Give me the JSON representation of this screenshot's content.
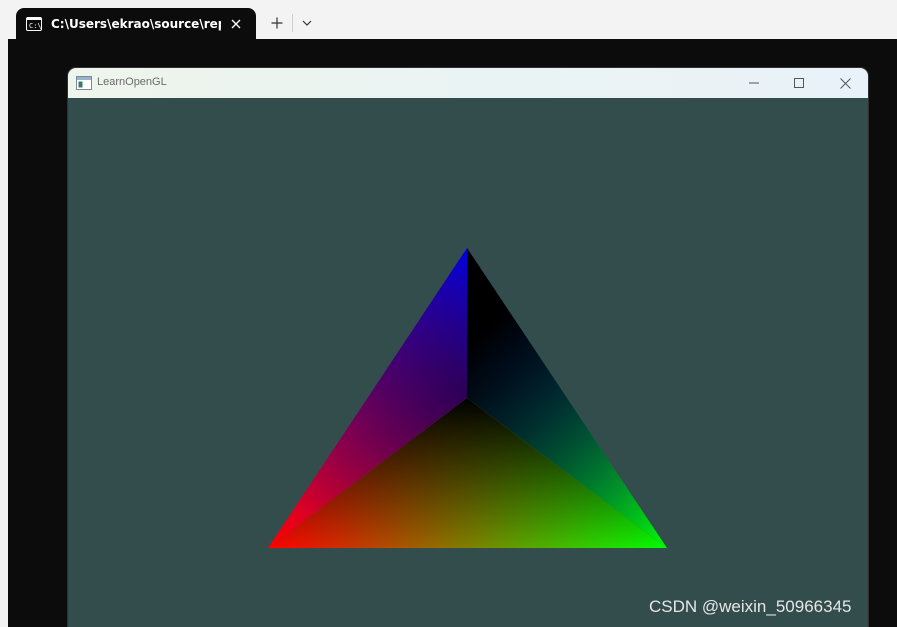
{
  "terminal": {
    "tab_title": "C:\\Users\\ekrao\\source\\repos\\",
    "tab_icon": "terminal-icon",
    "new_tab_icon": "plus-icon",
    "dropdown_icon": "chevron-down-icon",
    "close_icon": "close-icon"
  },
  "gl_window": {
    "title": "LearnOpenGL",
    "app_icon": "window-app-icon",
    "minimize_icon": "minimize-icon",
    "maximize_icon": "maximize-icon",
    "close_icon": "close-icon",
    "clear_color": "#334d4d",
    "vertex_colors": {
      "bottom_left": "#ff0000",
      "bottom_right": "#00ff00",
      "top": "#0000ff",
      "center": "#000000"
    }
  },
  "watermark": "CSDN @weixin_50966345"
}
